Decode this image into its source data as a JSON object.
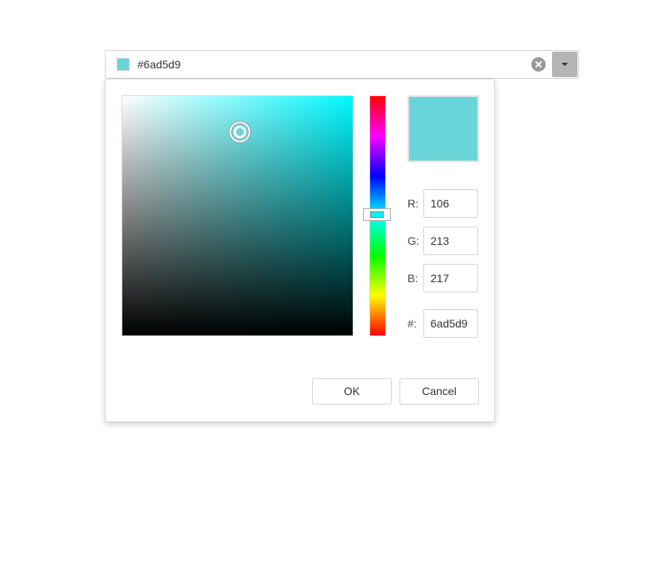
{
  "combo": {
    "value_text": "#6ad5d9",
    "swatch_color": "#6ad5d9",
    "clear_icon": "clear-circle-x-icon",
    "dropdown_icon": "caret-down-icon"
  },
  "picker": {
    "hue_color": "#00f8ff",
    "current_color": "#6ad5d9",
    "saturation": 0.51,
    "brightness": 0.85,
    "hue_degrees": 182,
    "labels": {
      "r": "R:",
      "g": "G:",
      "b": "B:",
      "hex": "#:"
    },
    "values": {
      "r": "106",
      "g": "213",
      "b": "217",
      "hex": "6ad5d9"
    }
  },
  "buttons": {
    "ok": "OK",
    "cancel": "Cancel"
  }
}
